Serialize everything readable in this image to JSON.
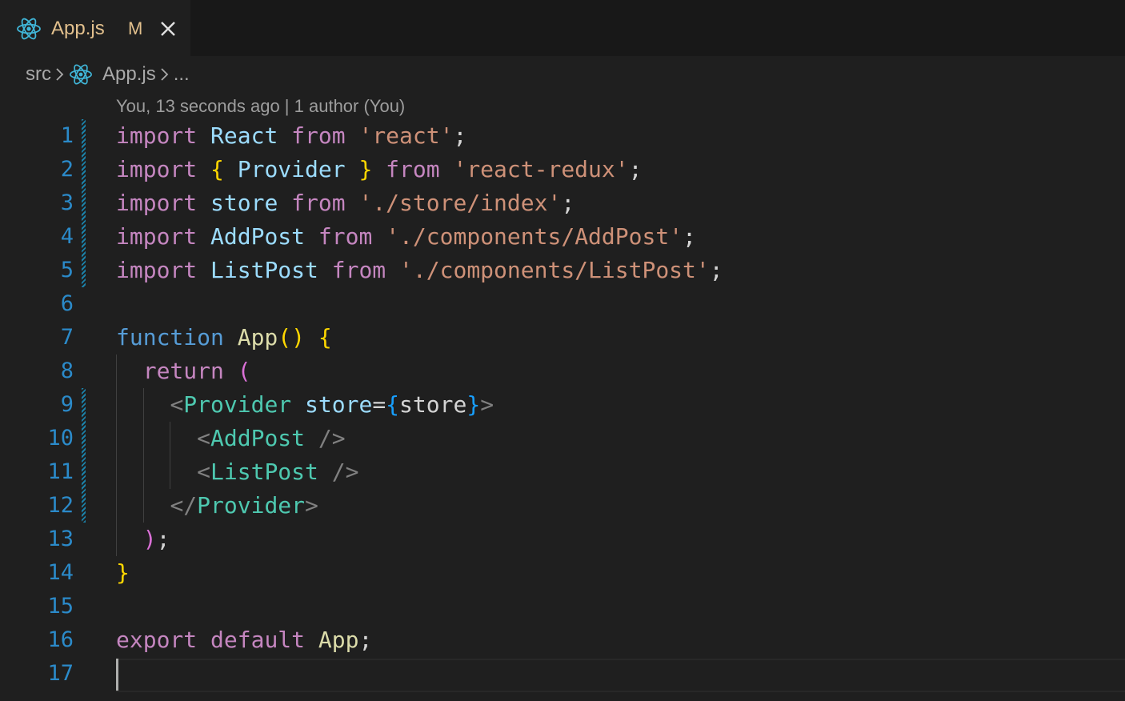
{
  "tab": {
    "filename": "App.js",
    "status": "M",
    "icon": "react-icon",
    "close_icon": "close-icon"
  },
  "breadcrumb": {
    "folder": "src",
    "file": "App.js",
    "more": "..."
  },
  "blame": "You, 13 seconds ago | 1 author (You)",
  "colors": {
    "line_number": "#2b8ac9",
    "modified_tab": "#e2c08d",
    "keyword": "#569cd6",
    "control": "#c586c0",
    "string": "#ce9178",
    "variable": "#9cdcfe",
    "function": "#dcdcaa",
    "tag": "#4ec9b0",
    "bracket_gold": "#ffd700"
  },
  "lines": [
    {
      "number": "1",
      "tokens": [
        [
          "ctl",
          "import"
        ],
        [
          "plain",
          " "
        ],
        [
          "var",
          "React"
        ],
        [
          "plain",
          " "
        ],
        [
          "ctl",
          "from"
        ],
        [
          "plain",
          " "
        ],
        [
          "str",
          "'react'"
        ],
        [
          "plain",
          ";"
        ]
      ]
    },
    {
      "number": "2",
      "tokens": [
        [
          "ctl",
          "import"
        ],
        [
          "plain",
          " "
        ],
        [
          "br1",
          "{"
        ],
        [
          "plain",
          " "
        ],
        [
          "var",
          "Provider"
        ],
        [
          "plain",
          " "
        ],
        [
          "br1",
          "}"
        ],
        [
          "plain",
          " "
        ],
        [
          "ctl",
          "from"
        ],
        [
          "plain",
          " "
        ],
        [
          "str",
          "'react-redux'"
        ],
        [
          "plain",
          ";"
        ]
      ]
    },
    {
      "number": "3",
      "tokens": [
        [
          "ctl",
          "import"
        ],
        [
          "plain",
          " "
        ],
        [
          "var",
          "store"
        ],
        [
          "plain",
          " "
        ],
        [
          "ctl",
          "from"
        ],
        [
          "plain",
          " "
        ],
        [
          "str",
          "'./store/index'"
        ],
        [
          "plain",
          ";"
        ]
      ]
    },
    {
      "number": "4",
      "tokens": [
        [
          "ctl",
          "import"
        ],
        [
          "plain",
          " "
        ],
        [
          "var",
          "AddPost"
        ],
        [
          "plain",
          " "
        ],
        [
          "ctl",
          "from"
        ],
        [
          "plain",
          " "
        ],
        [
          "str",
          "'./components/AddPost'"
        ],
        [
          "plain",
          ";"
        ]
      ]
    },
    {
      "number": "5",
      "tokens": [
        [
          "ctl",
          "import"
        ],
        [
          "plain",
          " "
        ],
        [
          "var",
          "ListPost"
        ],
        [
          "plain",
          " "
        ],
        [
          "ctl",
          "from"
        ],
        [
          "plain",
          " "
        ],
        [
          "str",
          "'./components/ListPost'"
        ],
        [
          "plain",
          ";"
        ]
      ]
    },
    {
      "number": "6",
      "tokens": []
    },
    {
      "number": "7",
      "tokens": [
        [
          "kw",
          "function"
        ],
        [
          "plain",
          " "
        ],
        [
          "fn",
          "App"
        ],
        [
          "br1",
          "()"
        ],
        [
          "plain",
          " "
        ],
        [
          "br1",
          "{"
        ]
      ]
    },
    {
      "number": "8",
      "tokens": [
        [
          "plain",
          "  "
        ],
        [
          "ctl",
          "return"
        ],
        [
          "plain",
          " "
        ],
        [
          "br2",
          "("
        ]
      ]
    },
    {
      "number": "9",
      "tokens": [
        [
          "plain",
          "    "
        ],
        [
          "punct",
          "<"
        ],
        [
          "tag",
          "Provider"
        ],
        [
          "plain",
          " "
        ],
        [
          "var",
          "store"
        ],
        [
          "plain",
          "="
        ],
        [
          "br3",
          "{"
        ],
        [
          "plain",
          "store"
        ],
        [
          "br3",
          "}"
        ],
        [
          "punct",
          ">"
        ]
      ]
    },
    {
      "number": "10",
      "tokens": [
        [
          "plain",
          "      "
        ],
        [
          "punct",
          "<"
        ],
        [
          "tag",
          "AddPost"
        ],
        [
          "plain",
          " "
        ],
        [
          "punct",
          "/>"
        ]
      ]
    },
    {
      "number": "11",
      "tokens": [
        [
          "plain",
          "      "
        ],
        [
          "punct",
          "<"
        ],
        [
          "tag",
          "ListPost"
        ],
        [
          "plain",
          " "
        ],
        [
          "punct",
          "/>"
        ]
      ]
    },
    {
      "number": "12",
      "tokens": [
        [
          "plain",
          "    "
        ],
        [
          "punct",
          "</"
        ],
        [
          "tag",
          "Provider"
        ],
        [
          "punct",
          ">"
        ]
      ]
    },
    {
      "number": "13",
      "tokens": [
        [
          "plain",
          "  "
        ],
        [
          "br2",
          ")"
        ],
        [
          "plain",
          ";"
        ]
      ]
    },
    {
      "number": "14",
      "tokens": [
        [
          "br1",
          "}"
        ]
      ]
    },
    {
      "number": "15",
      "tokens": []
    },
    {
      "number": "16",
      "tokens": [
        [
          "ctl",
          "export"
        ],
        [
          "plain",
          " "
        ],
        [
          "ctl",
          "default"
        ],
        [
          "plain",
          " "
        ],
        [
          "fn",
          "App"
        ],
        [
          "plain",
          ";"
        ]
      ]
    },
    {
      "number": "17",
      "tokens": []
    }
  ]
}
